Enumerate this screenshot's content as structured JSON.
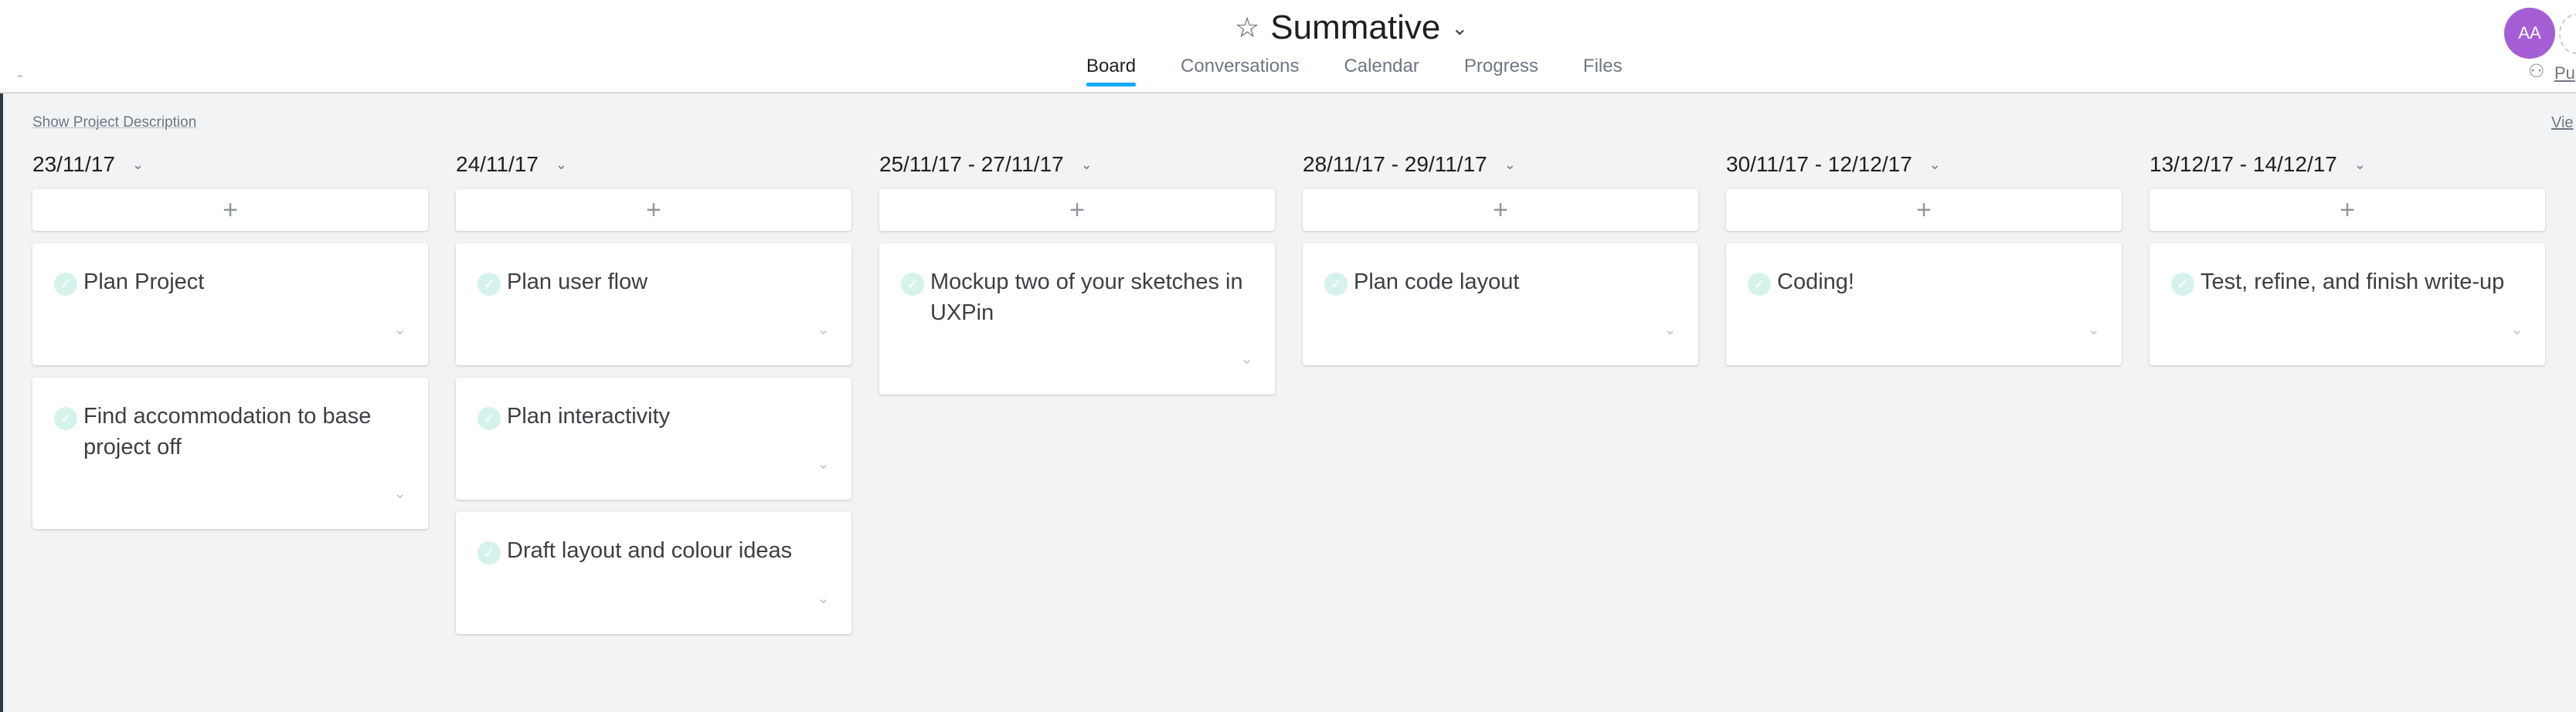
{
  "header": {
    "title": "Summative",
    "tabs": [
      "Board",
      "Conversations",
      "Calendar",
      "Progress",
      "Files"
    ],
    "active_tab": "Board",
    "avatar_initials": "AA",
    "public_link_label": "Pu"
  },
  "board": {
    "show_description_label": "Show Project Description",
    "view_label": "Vie",
    "columns": [
      {
        "title": "23/11/17",
        "tasks": [
          "Plan Project",
          "Find accommodation to base project off"
        ]
      },
      {
        "title": "24/11/17",
        "tasks": [
          "Plan user flow",
          "Plan interactivity",
          "Draft layout and colour ideas"
        ]
      },
      {
        "title": "25/11/17 - 27/11/17",
        "tasks": [
          "Mockup two of your sketches in UXPin"
        ]
      },
      {
        "title": "28/11/17 - 29/11/17",
        "tasks": [
          "Plan code layout"
        ]
      },
      {
        "title": "30/11/17 - 12/12/17",
        "tasks": [
          "Coding!"
        ]
      },
      {
        "title": "13/12/17 - 14/12/17",
        "tasks": [
          "Test, refine, and finish write-up"
        ]
      }
    ]
  },
  "icons": {
    "star": "star-icon",
    "caret": "chevron-down-icon",
    "add": "plus-icon",
    "check": "check-circle-icon",
    "people": "people-icon"
  },
  "colors": {
    "accent": "#14aaf5",
    "avatar": "#a65ed6",
    "check": "#d5f3ec",
    "background": "#f1f3f4"
  }
}
